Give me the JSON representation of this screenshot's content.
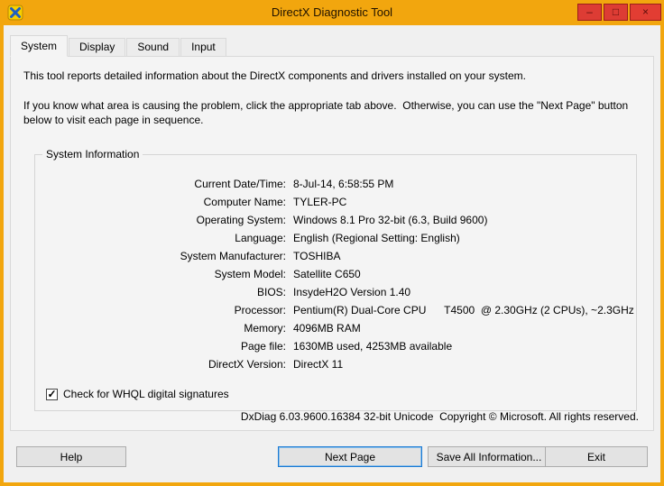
{
  "window": {
    "title": "DirectX Diagnostic Tool",
    "controls": {
      "minimize": "–",
      "maximize": "□",
      "close": "×"
    },
    "frame_color": "#f2a60e",
    "control_color": "#dd3c34"
  },
  "tabs": [
    {
      "label": "System",
      "active": true
    },
    {
      "label": "Display",
      "active": false
    },
    {
      "label": "Sound",
      "active": false
    },
    {
      "label": "Input",
      "active": false
    }
  ],
  "intro": {
    "line1": "This tool reports detailed information about the DirectX components and drivers installed on your system.",
    "line2": "If you know what area is causing the problem, click the appropriate tab above.  Otherwise, you can use the \"Next Page\" button below to visit each page in sequence."
  },
  "system_info": {
    "group_label": "System Information",
    "fields": [
      {
        "label": "Current Date/Time:",
        "value": "8-Jul-14, 6:58:55 PM"
      },
      {
        "label": "Computer Name:",
        "value": "TYLER-PC"
      },
      {
        "label": "Operating System:",
        "value": "Windows 8.1 Pro 32-bit (6.3, Build 9600)"
      },
      {
        "label": "Language:",
        "value": "English (Regional Setting: English)"
      },
      {
        "label": "System Manufacturer:",
        "value": "TOSHIBA"
      },
      {
        "label": "System Model:",
        "value": "Satellite C650"
      },
      {
        "label": "BIOS:",
        "value": "InsydeH2O Version 1.40"
      },
      {
        "label": "Processor:",
        "value": "Pentium(R) Dual-Core CPU      T4500  @ 2.30GHz (2 CPUs), ~2.3GHz"
      },
      {
        "label": "Memory:",
        "value": "4096MB RAM"
      },
      {
        "label": "Page file:",
        "value": "1630MB used, 4253MB available"
      },
      {
        "label": "DirectX Version:",
        "value": "DirectX 11"
      }
    ]
  },
  "whql": {
    "label": "Check for WHQL digital signatures",
    "checked": true
  },
  "status_line": "DxDiag 6.03.9600.16384 32-bit Unicode  Copyright © Microsoft. All rights reserved.",
  "buttons": {
    "help": "Help",
    "next_page": "Next Page",
    "save_all": "Save All Information...",
    "exit": "Exit"
  }
}
